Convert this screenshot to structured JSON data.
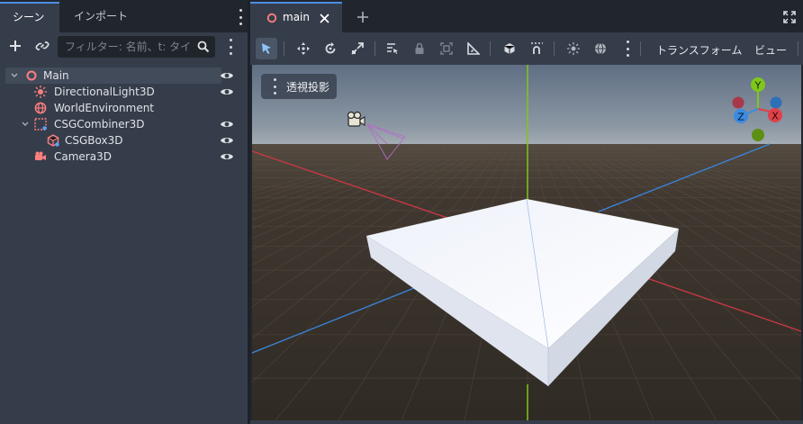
{
  "dock": {
    "tabs": [
      {
        "label": "シーン",
        "active": true
      },
      {
        "label": "インポート",
        "active": false
      }
    ],
    "filter": {
      "placeholder": "フィルター: 名前、t: タイプ"
    },
    "tree": [
      {
        "label": "Main",
        "icon": "node3d-icon",
        "expanded": true,
        "selected": true,
        "visible_icon": "eye-icon"
      },
      {
        "label": "DirectionalLight3D",
        "icon": "directional-light-icon",
        "visible_icon": "eye-icon"
      },
      {
        "label": "WorldEnvironment",
        "icon": "world-environment-icon"
      },
      {
        "label": "CSGCombiner3D",
        "icon": "csg-combiner-icon",
        "expanded": true,
        "visible_icon": "eye-icon"
      },
      {
        "label": "CSGBox3D",
        "icon": "csg-box-icon",
        "visible_icon": "eye-icon"
      },
      {
        "label": "Camera3D",
        "icon": "camera-icon",
        "visible_icon": "eye-icon"
      }
    ]
  },
  "editor": {
    "scene_tab": {
      "label": "main"
    },
    "toolbar": {
      "transform_menu": "トランスフォーム",
      "view_menu": "ビュー"
    },
    "viewport": {
      "perspective_label": "透視投影",
      "gizmo": {
        "y": "Y",
        "x": "X",
        "z": "Z"
      }
    }
  },
  "colors": {
    "accent": "#4d8fe3",
    "node_red": "#fc7f7f",
    "axis_x": "#e0404a",
    "axis_y": "#7fc71a",
    "axis_z": "#3b8be0"
  }
}
